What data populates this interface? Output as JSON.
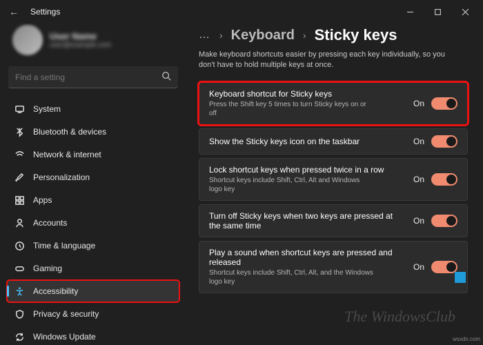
{
  "window": {
    "title": "Settings"
  },
  "sidebar": {
    "search_placeholder": "Find a setting",
    "profile_name": "User Name",
    "profile_mail": "user@example.com",
    "items": [
      {
        "label": "System"
      },
      {
        "label": "Bluetooth & devices"
      },
      {
        "label": "Network & internet"
      },
      {
        "label": "Personalization"
      },
      {
        "label": "Apps"
      },
      {
        "label": "Accounts"
      },
      {
        "label": "Time & language"
      },
      {
        "label": "Gaming"
      },
      {
        "label": "Accessibility"
      },
      {
        "label": "Privacy & security"
      },
      {
        "label": "Windows Update"
      }
    ]
  },
  "main": {
    "breadcrumbs": {
      "parent": "Keyboard",
      "current": "Sticky keys"
    },
    "description": "Make keyboard shortcuts easier by pressing each key individually, so you don't have to hold multiple keys at once.",
    "settings": [
      {
        "title": "Keyboard shortcut for Sticky keys",
        "sub": "Press the Shift key 5 times to turn Sticky keys on or off",
        "state": "On"
      },
      {
        "title": "Show the Sticky keys icon on the taskbar",
        "sub": "",
        "state": "On"
      },
      {
        "title": "Lock shortcut keys when pressed twice in a row",
        "sub": "Shortcut keys include Shift, Ctrl, Alt and Windows logo key",
        "state": "On"
      },
      {
        "title": "Turn off Sticky keys when two keys are pressed at the same time",
        "sub": "",
        "state": "On"
      },
      {
        "title": "Play a sound when shortcut keys are pressed and released",
        "sub": "Shortcut keys include Shift, Ctrl, Alt, and the Windows logo key",
        "state": "On"
      }
    ]
  },
  "watermark": "The WindowsClub",
  "source": "wsxdn.com"
}
